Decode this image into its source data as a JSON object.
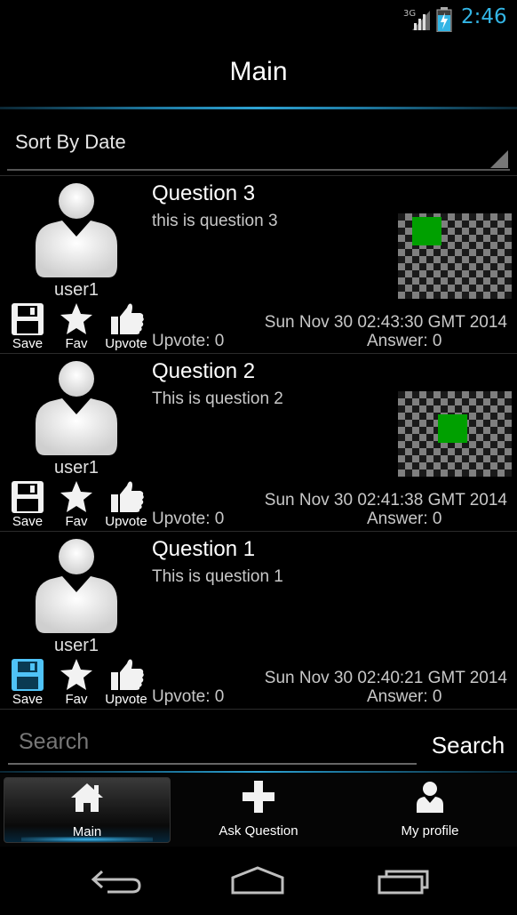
{
  "status_bar": {
    "network": "3G",
    "time": "2:46",
    "time_color": "#33b5e5"
  },
  "title_bar": {
    "title": "Main"
  },
  "sort": {
    "label": "Sort By Date"
  },
  "questions": [
    {
      "user": "user1",
      "title": "Question 3",
      "body": "this is question 3",
      "date": "Sun Nov 30 02:43:30 GMT 2014",
      "upvotes": "Upvote: 0",
      "answers": "Answer: 0",
      "has_image": true,
      "image_green_cell": "col1-row1",
      "saved": false,
      "actions": {
        "save": "Save",
        "fav": "Fav",
        "upvote": "Upvote"
      }
    },
    {
      "user": "user1",
      "title": "Question 2",
      "body": "This is question 2",
      "date": "Sun Nov 30 02:41:38 GMT 2014",
      "upvotes": "Upvote: 0",
      "answers": "Answer: 0",
      "has_image": true,
      "image_green_cell": "col3-row2",
      "saved": false,
      "actions": {
        "save": "Save",
        "fav": "Fav",
        "upvote": "Upvote"
      }
    },
    {
      "user": "user1",
      "title": "Question 1",
      "body": "This is question 1",
      "date": "Sun Nov 30 02:40:21 GMT 2014",
      "upvotes": "Upvote: 0",
      "answers": "Answer: 0",
      "has_image": false,
      "saved": true,
      "actions": {
        "save": "Save",
        "fav": "Fav",
        "upvote": "Upvote"
      }
    }
  ],
  "search": {
    "placeholder": "Search",
    "value": "",
    "button_label": "Search"
  },
  "tabs": [
    {
      "label": "Main",
      "icon": "home-icon",
      "active": true
    },
    {
      "label": "Ask Question",
      "icon": "plus-icon",
      "active": false
    },
    {
      "label": "My profile",
      "icon": "user-icon",
      "active": false
    }
  ],
  "colors": {
    "accent": "#33b5e5",
    "saved_icon": "#4fc3f7",
    "image_green": "#00a000"
  }
}
